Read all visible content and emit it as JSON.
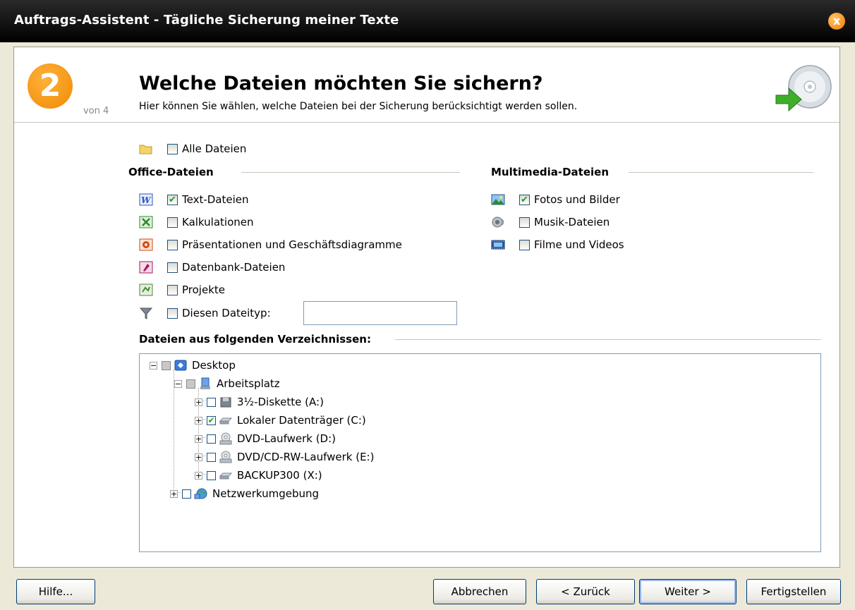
{
  "window": {
    "title": "Auftrags-Assistent - Tägliche Sicherung meiner Texte",
    "close_icon": "x"
  },
  "header": {
    "step_number": "2",
    "step_of": "von 4",
    "title": "Welche Dateien möchten Sie sichern?",
    "subtitle": "Hier können Sie wählen, welche Dateien bei der Sicherung berücksichtigt werden sollen."
  },
  "all_files": {
    "label": "Alle Dateien",
    "checked": false
  },
  "office": {
    "heading": "Office-Dateien",
    "items": [
      {
        "label": "Text-Dateien",
        "checked": true,
        "icon": "word-icon"
      },
      {
        "label": "Kalkulationen",
        "checked": false,
        "icon": "excel-icon"
      },
      {
        "label": "Präsentationen und Geschäftsdiagramme",
        "checked": false,
        "icon": "powerpoint-icon"
      },
      {
        "label": "Datenbank-Dateien",
        "checked": false,
        "icon": "access-icon"
      },
      {
        "label": "Projekte",
        "checked": false,
        "icon": "project-icon"
      },
      {
        "label": "Diesen Dateityp:",
        "checked": false,
        "icon": "filter-icon"
      }
    ],
    "filetype_value": ""
  },
  "multimedia": {
    "heading": "Multimedia-Dateien",
    "items": [
      {
        "label": "Fotos und Bilder",
        "checked": true,
        "icon": "picture-icon"
      },
      {
        "label": "Musik-Dateien",
        "checked": false,
        "icon": "speaker-icon"
      },
      {
        "label": "Filme und Videos",
        "checked": false,
        "icon": "film-icon"
      }
    ]
  },
  "folders": {
    "heading": "Dateien aus folgenden Verzeichnissen:",
    "tree": [
      {
        "label": "Desktop",
        "expander": "−",
        "checked": false,
        "partial": true
      },
      {
        "label": "Arbeitsplatz",
        "expander": "−",
        "checked": false,
        "partial": true
      },
      {
        "label": "3½-Diskette (A:)",
        "expander": "+",
        "checked": false,
        "partial": false
      },
      {
        "label": "Lokaler Datenträger (C:)",
        "expander": "+",
        "checked": true,
        "partial": false
      },
      {
        "label": "DVD-Laufwerk (D:)",
        "expander": "+",
        "checked": false,
        "partial": false
      },
      {
        "label": "DVD/CD-RW-Laufwerk (E:)",
        "expander": "+",
        "checked": false,
        "partial": false
      },
      {
        "label": "BACKUP300 (X:)",
        "expander": "+",
        "checked": false,
        "partial": false
      },
      {
        "label": "Netzwerkumgebung",
        "expander": "+",
        "checked": false,
        "partial": false
      }
    ]
  },
  "buttons": {
    "help": "Hilfe...",
    "cancel": "Abbrechen",
    "back": "< Zurück",
    "next": "Weiter >",
    "finish": "Fertigstellen"
  },
  "colors": {
    "accent": "#f08a00",
    "check": "#21a121",
    "titlebar": "#111111"
  }
}
